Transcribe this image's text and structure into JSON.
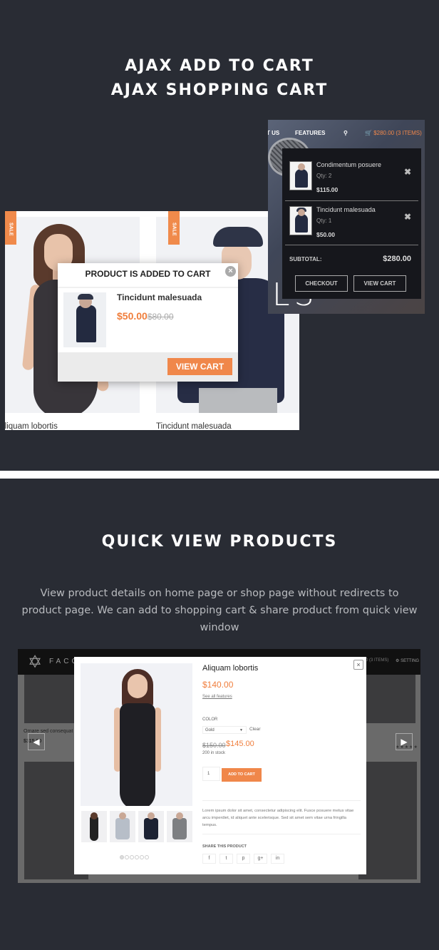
{
  "section1": {
    "title_line1": "AJAX ADD TO CART",
    "title_line2": "AJAX SHOPPING CART",
    "products": [
      {
        "name": "Aliquam lobortis",
        "badge": "SALE"
      },
      {
        "name": "Tincidunt malesuada",
        "badge": "SALE"
      }
    ],
    "added_popup": {
      "title": "PRODUCT IS ADDED TO CART",
      "close_icon": "close-circle-icon",
      "product_name": "Tincidunt malesuada",
      "price": "$50.00",
      "old_price": "$80.00",
      "view_cart_label": "VIEW CART"
    },
    "site_nav": {
      "items": [
        "ABOUT US",
        "FEATURES"
      ],
      "search_icon": "search-icon",
      "cart_icon": "cart-icon",
      "cart_summary": "$280.00 (3 ITEMS)",
      "hero_text": "LS"
    },
    "mini_cart": {
      "items": [
        {
          "name": "Condimentum posuere",
          "qty": "Qty: 2",
          "price": "$115.00"
        },
        {
          "name": "Tincidunt malesuada",
          "qty": "Qty: 1",
          "price": "$50.00"
        }
      ],
      "remove_icon": "close-icon",
      "subtotal_label": "SUBTOTAL:",
      "subtotal_value": "$280.00",
      "checkout_label": "CHECKOUT",
      "view_cart_label": "VIEW CART"
    }
  },
  "section2": {
    "title": "QUICK VIEW PRODUCTS",
    "description": "View product details on home page or shop page without redirects to product page. We can add to shopping cart & share product from quick view window",
    "background_site": {
      "brand": "FACO",
      "cart_summary": "0 (3 ITEMS)",
      "setting_label": "SETTING",
      "bg_product_name": "Ornare sed consequat",
      "bg_product_price": "$315.00",
      "prev_icon": "arrow-left-icon",
      "next_icon": "arrow-right-icon",
      "rating_stars": "★★★★★"
    },
    "quick_view": {
      "product_name": "Aliquam lobortis",
      "price": "$140.00",
      "features_link": "See all features",
      "color_label": "COLOR",
      "color_selected": "Gold",
      "clear_label": "Clear",
      "old_price": "$150.00",
      "new_price": "$145.00",
      "stock": "200 in stock",
      "quantity": "1",
      "add_to_cart_label": "ADD TO CART",
      "description": "Lorem ipsum dolor sit amet, consectetur adipiscing elit. Fusce posuere metus vitae arcu imperdiet, id aliquet ante scelerisque. Sed sit amet sem vitae urna fringilla tempus.",
      "share_label": "SHARE THIS PRODUCT",
      "share_icons": [
        "f",
        "t",
        "p",
        "g+",
        "in"
      ],
      "gallery_dots": 6,
      "gallery_active_dot": 1,
      "close_label": "×"
    }
  },
  "colors": {
    "background": "#292c34",
    "accent": "#f0874a",
    "price": "#f07e3c"
  }
}
